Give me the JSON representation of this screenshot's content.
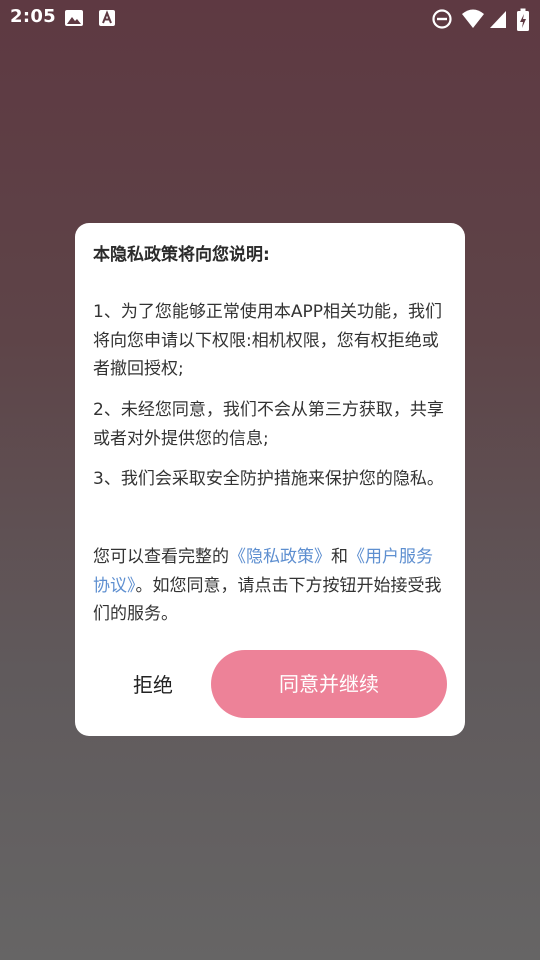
{
  "status_bar": {
    "time": "2:05",
    "left_icons": [
      "image-icon",
      "font-download-icon"
    ],
    "right_icons": [
      "do-not-disturb-icon",
      "wifi-icon",
      "cellular-signal-icon",
      "battery-charging-icon"
    ]
  },
  "dialog": {
    "title": "本隐私政策将向您说明:",
    "paragraph_1": "1、为了您能够正常使用本APP相关功能，我们将向您申请以下权限:相机权限，您有权拒绝或者撤回授权;",
    "paragraph_2": "2、未经您同意，我们不会从第三方获取，共享或者对外提供您的信息;",
    "paragraph_3": "3、我们会采取安全防护措施来保护您的隐私。",
    "paragraph_4": {
      "prefix": "您可以查看完整的",
      "privacy_policy_link": "《隐私政策》",
      "connector": "和",
      "user_agreement_link": "《用户服务协议》",
      "suffix": "。如您同意，请点击下方按钮开始接受我们的服务。"
    },
    "refuse_label": "拒绝",
    "agree_label": "同意并继续"
  },
  "colors": {
    "accent_button": "#ed8298",
    "link": "#5e8fd0",
    "background_top": "#5e3942",
    "background_bottom": "#666565"
  }
}
